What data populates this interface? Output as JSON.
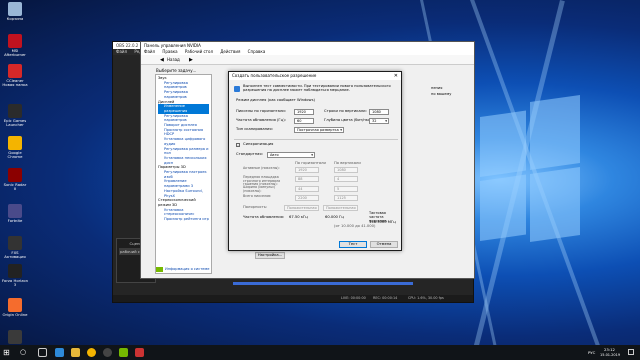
{
  "desktop": {
    "icons": [
      {
        "label": "Корзина",
        "color": "#9ab7d6"
      },
      {
        "label": "MSI Afterburner",
        "color": "#c1121f"
      },
      {
        "label": "CCleaner Новая папка",
        "color": "#d62828"
      },
      {
        "label": "Epic Games Launcher",
        "color": "#2b2b2b"
      },
      {
        "label": "Google Chrome",
        "color": "#f4b400"
      },
      {
        "label": "Sonic Radar II",
        "color": "#8b0000"
      },
      {
        "label": "Fortnite",
        "color": "#4a4a8a"
      },
      {
        "label": "FXS Активация",
        "color": "#333333"
      },
      {
        "label": "Forza Horizon 3",
        "color": "#222222"
      },
      {
        "label": "Origin Online",
        "color": "#f56c2d"
      },
      {
        "label": "OBS Studio",
        "color": "#3a3a3a"
      }
    ]
  },
  "obs": {
    "title": "OBS 22.0.2 (64-bit)...",
    "menu": [
      "Файл",
      "Редактировать"
    ],
    "scenes_header": "Сцены",
    "scene_item": "рабочий стол",
    "status_time1": "LIVE: 00:00:00",
    "status_time2": "REC: 00:00:14",
    "status_cpu": "CPU: 1.6%, 30.00 fps"
  },
  "nvidia": {
    "title": "Панель управления NVIDIA",
    "menu": [
      "Файл",
      "Правка",
      "Рабочий стол",
      "Действия",
      "Справка"
    ],
    "back_label": "Назад",
    "task_header": "Выберите задачу...",
    "tree": [
      {
        "t": "Звук",
        "k": "g"
      },
      {
        "t": "Регулировка параметров",
        "k": "l"
      },
      {
        "t": "Регулировка параметров",
        "k": "l"
      },
      {
        "t": "Дисплей",
        "k": "g"
      },
      {
        "t": "Изменение разрешения",
        "k": "sel"
      },
      {
        "t": "Регулировка параметров",
        "k": "l"
      },
      {
        "t": "Поворот дисплея",
        "k": "l"
      },
      {
        "t": "Просмотр состояния HDCP",
        "k": "l"
      },
      {
        "t": "Установка цифрового аудио",
        "k": "l"
      },
      {
        "t": "Регулировка размера и пол",
        "k": "l"
      },
      {
        "t": "Установка нескольких дисп",
        "k": "l"
      },
      {
        "t": "Параметры 3D",
        "k": "g"
      },
      {
        "t": "Регулировка настроек изоб",
        "k": "l"
      },
      {
        "t": "Управление параметрами 3",
        "k": "l"
      },
      {
        "t": "Настройка Surround, PhysX",
        "k": "l"
      },
      {
        "t": "Стереоскопический режим 3D",
        "k": "g"
      },
      {
        "t": "Установка стереоскопичес",
        "k": "l"
      },
      {
        "t": "Просмотр рейтинга игр",
        "k": "l"
      }
    ],
    "info_link": "Информация о системе",
    "side_text": "нения",
    "side_text2": "по вашему",
    "setup_button": "Настройка..."
  },
  "dialog": {
    "title": "Создать пользовательское разрешение",
    "info": "Выполнен тест совместимости. При тестировании нового пользовательского разрешения на дисплее может наблюдаться мерцание.",
    "mode_label": "Режим дисплея (как сообщает Windows)",
    "horiz_pixels_label": "Пикселы по горизонтали:",
    "horiz_pixels": "1920",
    "vert_lines_label": "Строки по вертикали:",
    "vert_lines": "1080",
    "refresh_label": "Частота обновления (Гц):",
    "refresh": "60",
    "color_depth_label": "Глубина цвета (бит/пкс):",
    "color_depth": "32",
    "scan_label": "Тип сканирования:",
    "scan": "Построчная развертка",
    "sync_header": "Синхронизация",
    "standard_label": "Стандартная:",
    "standard": "Авто",
    "col_h": "По горизонтали",
    "col_v": "По вертикали",
    "rows": [
      {
        "label": "Активные (пикселы):",
        "h": "1920",
        "v": "1080"
      },
      {
        "label": "Передняя площадка строчного интервала гашения (пикселы):",
        "h": "88",
        "v": "4"
      },
      {
        "label": "Ширина (импульс) (пикселы):",
        "h": "44",
        "v": "5"
      },
      {
        "label": "Всего пикселов:",
        "h": "2200",
        "v": "1125"
      }
    ],
    "polarity_label": "Полярность:",
    "polarity_h": "Положительная",
    "polarity_v": "Положительная",
    "refresh_rate_label": "Частота обновления:",
    "refresh_rate_value": "67.50 кГц",
    "refresh_rate_v": "60.000 Гц",
    "pixel_clock_label": "Тактовая частота пикселов:",
    "pixel_clock": "148.5000 МГц",
    "pixel_clock_note": "(от 10.000 до 41.000)",
    "test_button": "Тест",
    "cancel_button": "Отмена"
  },
  "taskbar": {
    "time": "23:12",
    "date": "15.01.2019",
    "lang": "РУС"
  }
}
